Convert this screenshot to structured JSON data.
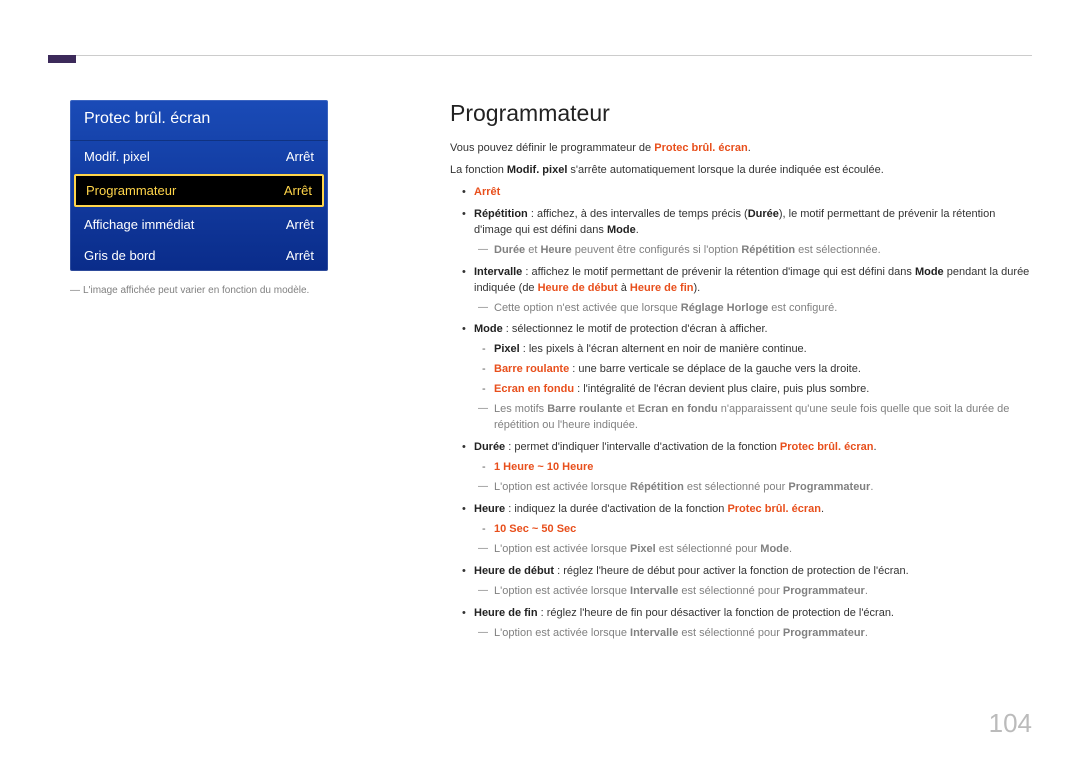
{
  "pageNumber": "104",
  "menu": {
    "title": "Protec brûl. écran",
    "rows": [
      {
        "label": "Modif. pixel",
        "value": "Arrêt",
        "selected": false
      },
      {
        "label": "Programmateur",
        "value": "Arrêt",
        "selected": true
      },
      {
        "label": "Affichage immédiat",
        "value": "Arrêt",
        "selected": false
      },
      {
        "label": "Gris de bord",
        "value": "Arrêt",
        "selected": false
      }
    ],
    "caption_prefix": "―",
    "caption": "L'image affichée peut varier en fonction du modèle."
  },
  "content": {
    "heading": "Programmateur",
    "intro1a": "Vous pouvez définir le programmateur de ",
    "intro1b": "Protec brûl. écran",
    "intro1c": ".",
    "intro2a": "La fonction ",
    "intro2b": "Modif. pixel",
    "intro2c": " s'arrête automatiquement lorsque la durée indiquée est écoulée.",
    "b_arret": "Arrêt",
    "b_rep_label": "Répétition",
    "b_rep_text1": " : affichez, à des intervalles de temps précis (",
    "b_rep_duree": "Durée",
    "b_rep_text2": "), le motif permettant de prévenir la rétention d'image qui est défini dans ",
    "b_rep_mode": "Mode",
    "b_rep_text3": ".",
    "n_rep_a": "Durée",
    "n_rep_b": " et ",
    "n_rep_c": "Heure",
    "n_rep_d": " peuvent être configurés si l'option ",
    "n_rep_e": "Répétition",
    "n_rep_f": " est sélectionnée.",
    "b_int_label": "Intervalle",
    "b_int_text1": " : affichez le motif permettant de prévenir la rétention d'image qui est défini dans ",
    "b_int_mode": "Mode",
    "b_int_text2": " pendant la durée indiquée (de ",
    "b_int_hd": "Heure de début",
    "b_int_text3": " à ",
    "b_int_hf": "Heure de fin",
    "b_int_text4": ").",
    "n_int_a": "Cette option n'est activée que lorsque ",
    "n_int_b": "Réglage Horloge",
    "n_int_c": " est configuré.",
    "b_mode_label": "Mode",
    "b_mode_text": " : sélectionnez le motif de protection d'écran à afficher.",
    "s_pixel_label": "Pixel",
    "s_pixel_text": " : les pixels à l'écran alternent en noir de manière continue.",
    "s_barre_label": "Barre roulante",
    "s_barre_text": " : une barre verticale se déplace de la gauche vers la droite.",
    "s_fondu_label": "Ecran en fondu",
    "s_fondu_text": " : l'intégralité de l'écran devient plus claire, puis plus sombre.",
    "n_mode_a": "Les motifs ",
    "n_mode_b": "Barre roulante",
    "n_mode_c": " et ",
    "n_mode_d": "Ecran en fondu",
    "n_mode_e": " n'apparaissent qu'une seule fois quelle que soit la durée de répétition ou l'heure indiquée.",
    "b_duree_label": "Durée",
    "b_duree_text1": " : permet d'indiquer l'intervalle d'activation de la fonction ",
    "b_duree_ref": "Protec brûl. écran",
    "b_duree_text2": ".",
    "s_duree_range": "1 Heure ~ 10 Heure",
    "n_duree_a": "L'option est activée lorsque ",
    "n_duree_b": "Répétition",
    "n_duree_c": " est sélectionné pour ",
    "n_duree_d": "Programmateur",
    "n_duree_e": ".",
    "b_heure_label": "Heure",
    "b_heure_text1": " : indiquez la durée d'activation de la fonction ",
    "b_heure_ref": "Protec brûl. écran",
    "b_heure_text2": ".",
    "s_heure_range": "10 Sec ~ 50 Sec",
    "n_heure_a": "L'option est activée lorsque ",
    "n_heure_b": "Pixel",
    "n_heure_c": " est sélectionné pour ",
    "n_heure_d": "Mode",
    "n_heure_e": ".",
    "b_hd_label": "Heure de début",
    "b_hd_text": " : réglez l'heure de début pour activer la fonction de protection de l'écran.",
    "n_hd_a": "L'option est activée lorsque ",
    "n_hd_b": "Intervalle",
    "n_hd_c": " est sélectionné pour ",
    "n_hd_d": "Programmateur",
    "n_hd_e": ".",
    "b_hf_label": "Heure de fin",
    "b_hf_text": " : réglez l'heure de fin pour désactiver la fonction de protection de l'écran.",
    "n_hf_a": "L'option est activée lorsque ",
    "n_hf_b": "Intervalle",
    "n_hf_c": " est sélectionné pour ",
    "n_hf_d": "Programmateur",
    "n_hf_e": "."
  }
}
